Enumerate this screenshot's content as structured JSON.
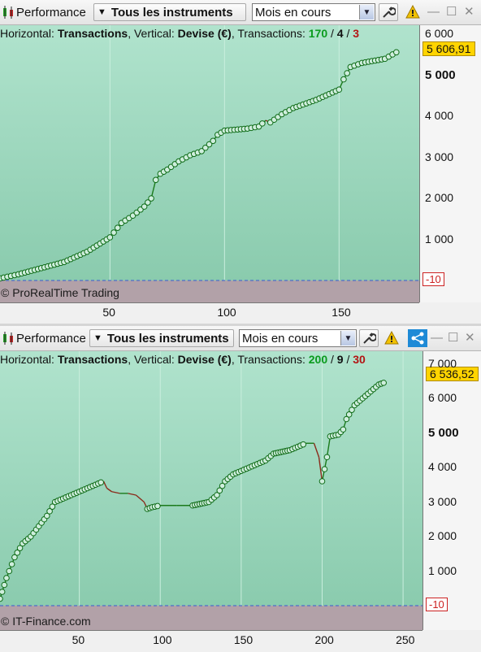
{
  "panels": [
    {
      "toolbar": {
        "performance_label": "Performance",
        "instruments_label": "Tous les instruments",
        "period_value": "Mois en cours"
      },
      "info": {
        "prefix": "Horizontal: ",
        "h_value": "Transactions",
        "mid": ", Vertical: ",
        "v_value": "Devise (€)",
        "suffix": ", Transactions: ",
        "count_total": "170",
        "count_neutral": "4",
        "count_loss": "3"
      },
      "copyright": "© ProRealTime Trading",
      "current_value": "5 606,91",
      "negative_marker": "-10",
      "y_ticks": [
        "6 000",
        "5 000",
        "4 000",
        "3 000",
        "2 000",
        "1 000"
      ],
      "x_ticks": [
        "50",
        "100",
        "150"
      ]
    },
    {
      "toolbar": {
        "performance_label": "Performance",
        "instruments_label": "Tous les instruments",
        "period_value": "Mois en cours"
      },
      "info": {
        "prefix": "Horizontal: ",
        "h_value": "Transactions",
        "mid": ", Vertical: ",
        "v_value": "Devise (€)",
        "suffix": ", Transactions: ",
        "count_total": "200",
        "count_neutral": "9",
        "count_loss": "30"
      },
      "copyright": "© IT-Finance.com",
      "current_value": "6 536,52",
      "negative_marker": "-10",
      "y_ticks": [
        "7 000",
        "6 000",
        "5 000",
        "4 000",
        "3 000",
        "2 000",
        "1 000"
      ],
      "x_ticks": [
        "50",
        "100",
        "150",
        "200",
        "250"
      ]
    }
  ],
  "chart_data": [
    {
      "type": "line",
      "xlabel": "Transactions",
      "ylabel": "Devise (€)",
      "xlim": [
        2,
        185
      ],
      "ylim": [
        -10,
        6100
      ],
      "x_ticks": [
        50,
        100,
        150
      ],
      "y_ticks": [
        1000,
        2000,
        3000,
        4000,
        5000,
        6000
      ],
      "last_value": 5606.91,
      "x": [
        2,
        10,
        20,
        30,
        40,
        50,
        55,
        60,
        65,
        68,
        70,
        72,
        75,
        80,
        85,
        90,
        95,
        97,
        100,
        110,
        115,
        118,
        120,
        125,
        130,
        140,
        150,
        152,
        155,
        160,
        170,
        175
      ],
      "y": [
        50,
        150,
        300,
        450,
        700,
        1050,
        1400,
        1580,
        1800,
        2000,
        2450,
        2600,
        2700,
        2900,
        3050,
        3150,
        3400,
        3550,
        3650,
        3700,
        3750,
        3900,
        3850,
        4050,
        4200,
        4400,
        4650,
        4900,
        5200,
        5300,
        5400,
        5560
      ],
      "series_colors": {
        "line": "#1b7a1b",
        "loss_segment": "#8a2a1a",
        "marker": "#0e6b16"
      }
    },
    {
      "type": "line",
      "xlabel": "Transactions",
      "ylabel": "Devise (€)",
      "xlim": [
        1,
        262
      ],
      "ylim": [
        -10,
        7200
      ],
      "x_ticks": [
        50,
        100,
        150,
        200,
        250
      ],
      "y_ticks": [
        1000,
        2000,
        3000,
        4000,
        5000,
        6000,
        7000
      ],
      "last_value": 6536.52,
      "x": [
        1,
        5,
        10,
        15,
        20,
        25,
        30,
        35,
        40,
        45,
        50,
        55,
        60,
        65,
        67,
        70,
        75,
        80,
        85,
        90,
        92,
        95,
        100,
        110,
        120,
        130,
        135,
        140,
        145,
        150,
        155,
        160,
        165,
        170,
        180,
        185,
        190,
        195,
        198,
        200,
        203,
        205,
        210,
        213,
        215,
        220,
        225,
        230,
        235,
        238
      ],
      "y": [
        200,
        800,
        1400,
        1800,
        2000,
        2300,
        2600,
        3000,
        3100,
        3200,
        3300,
        3400,
        3500,
        3600,
        3400,
        3300,
        3250,
        3250,
        3200,
        3000,
        2800,
        2850,
        2900,
        2900,
        2900,
        3000,
        3200,
        3600,
        3800,
        3900,
        4000,
        4100,
        4200,
        4400,
        4500,
        4600,
        4700,
        4700,
        4300,
        3600,
        4300,
        4900,
        4950,
        5100,
        5400,
        5800,
        6000,
        6200,
        6400,
        6450
      ],
      "series_colors": {
        "line": "#1b7a1b",
        "loss_segment": "#8a2a1a",
        "marker": "#0e6b16"
      }
    }
  ]
}
